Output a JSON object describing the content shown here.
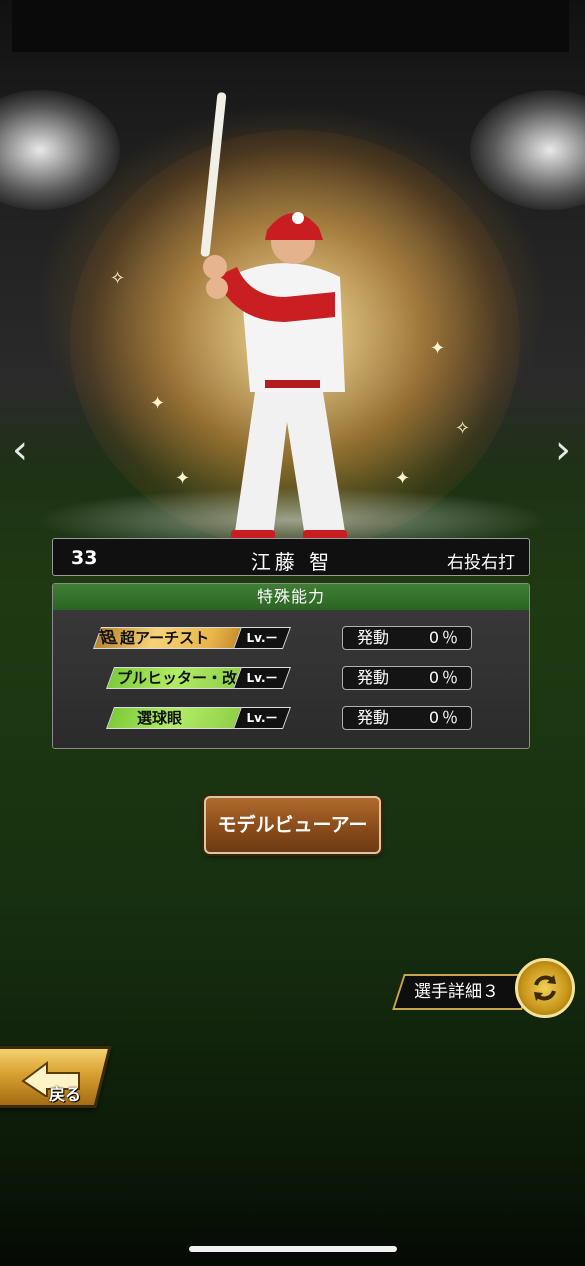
{
  "player": {
    "number": "33",
    "name": "江藤 智",
    "handedness": "右投右打"
  },
  "abilities": {
    "header": "特殊能力",
    "items": [
      {
        "super_mark": "超",
        "name": "超アーチスト",
        "level": "Lv.ー",
        "activation_label": "発動",
        "activation_value": "0％",
        "style": "gold"
      },
      {
        "super_mark": "",
        "name": "プルヒッター・改",
        "level": "Lv.ー",
        "activation_label": "発動",
        "activation_value": "0％",
        "style": "green"
      },
      {
        "super_mark": "",
        "name": "選球眼",
        "level": "Lv.ー",
        "activation_label": "発動",
        "activation_value": "0％",
        "style": "green"
      }
    ]
  },
  "buttons": {
    "model_viewer": "モデルビューアー",
    "player_detail": "選手詳細３",
    "back": "戻る"
  },
  "icons": {
    "prev": "chevron-left-icon",
    "next": "chevron-right-icon",
    "toggle": "swap-arrows-icon",
    "back": "back-arrow-icon"
  },
  "colors": {
    "ability_header": "#2c6424",
    "gold_ability": "#f7d27a",
    "green_ability": "#b2ec66",
    "model_button": "#8a4c1a",
    "detail_icon": "#c79418"
  }
}
